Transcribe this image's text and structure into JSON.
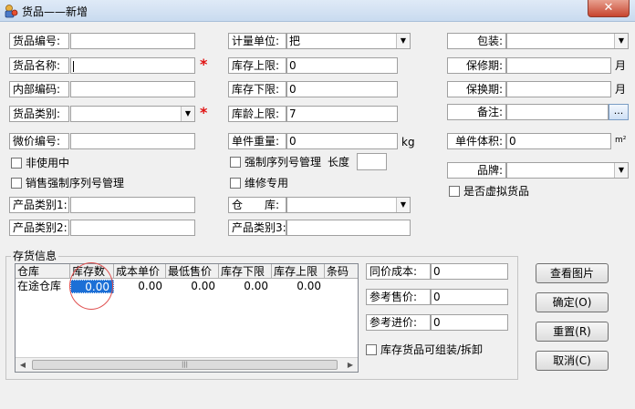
{
  "window": {
    "title": "货品——新增",
    "close_glyph": "✕"
  },
  "fields": {
    "code_label": "货品编号:",
    "code_value": "",
    "name_label": "货品名称:",
    "name_value": "",
    "internal_code_label": "内部编码:",
    "internal_code_value": "",
    "category_label": "货品类别:",
    "category_value": "",
    "minor_code_label": "微价编号:",
    "minor_code_value": "",
    "product_cat1_label": "产品类别1:",
    "product_cat1_value": "",
    "product_cat2_label": "产品类别2:",
    "product_cat2_value": "",
    "unit_label": "计量单位:",
    "unit_value": "把",
    "stock_upper_label": "库存上限:",
    "stock_upper_value": "0",
    "stock_lower_label": "库存下限:",
    "stock_lower_value": "0",
    "stock_age_label": "库龄上限:",
    "stock_age_value": "7",
    "weight_label": "单件重量:",
    "weight_value": "0",
    "weight_unit": "kg",
    "warehouse_label": "仓　　库:",
    "warehouse_value": "",
    "product_cat3_label": "产品类别3:",
    "product_cat3_value": "",
    "package_label": "包装:",
    "package_value": "",
    "warranty_label": "保修期:",
    "warranty_value": "",
    "warranty_unit": "月",
    "exchange_label": "保换期:",
    "exchange_value": "",
    "exchange_unit": "月",
    "remark_label": "备注:",
    "remark_value": "",
    "remark_button": "...",
    "volume_label": "单件体积:",
    "volume_value": "0",
    "volume_unit": "m²",
    "brand_label": "品牌:",
    "brand_value": ""
  },
  "checkboxes": {
    "inactive": "非使用中",
    "forced_serial": "强制序列号管理",
    "length_label": "长度",
    "length_value": "",
    "sales_serial": "销售强制序列号管理",
    "repair": "维修专用",
    "virtual": "是否虚拟货品",
    "assemble": "库存货品可组装/拆卸"
  },
  "stock_group": {
    "title": "存货信息",
    "columns": [
      "仓库",
      "库存数",
      "成本单价",
      "最低售价",
      "库存下限",
      "库存上限",
      "条码"
    ],
    "rows": [
      {
        "warehouse": "在途仓库",
        "qty": "0.00",
        "cost": "0.00",
        "min_price": "0.00",
        "lower": "0.00",
        "upper": "0.00",
        "barcode": ""
      }
    ],
    "same_cost_label": "同价成本:",
    "same_cost_value": "0",
    "ref_sale_label": "参考售价:",
    "ref_sale_value": "0",
    "ref_purchase_label": "参考进价:",
    "ref_purchase_value": "0"
  },
  "buttons": {
    "view_image": "查看图片",
    "ok": "确定(O)",
    "reset": "重置(R)",
    "cancel": "取消(C)"
  },
  "colors": {
    "required_star": "#e01010",
    "selection": "#1c6fd6",
    "annotation_circle": "#e05050"
  }
}
